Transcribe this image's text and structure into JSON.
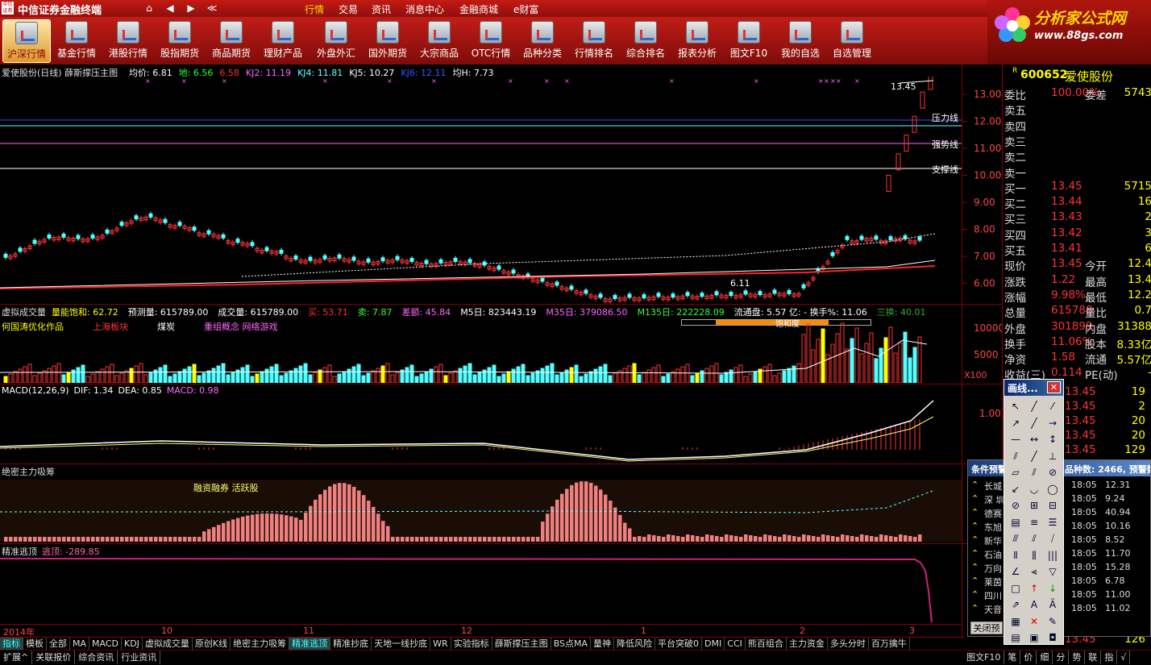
{
  "titlebar": {
    "logo": "中信证券",
    "app_title": "中信证券金融终端",
    "nav": [
      "⌂",
      "◀",
      "▶",
      "≪"
    ],
    "menu": [
      "行情",
      "交易",
      "资讯",
      "消息中心",
      "金融商城",
      "e财富"
    ]
  },
  "toolbar": {
    "items": [
      "沪深行情",
      "基金行情",
      "港股行情",
      "股指期货",
      "商品期货",
      "理财产品",
      "外盘外汇",
      "国外期货",
      "大宗商品",
      "OTC行情",
      "品种分类",
      "行情排名",
      "综合排名",
      "报表分析",
      "图文F10",
      "我的自选",
      "自选管理"
    ]
  },
  "brand": {
    "name": "分析家公式网",
    "url": "www.88gs.com"
  },
  "main_chart": {
    "title": "爱使股份(日线) 薛斯撑压主图",
    "indicators": [
      {
        "label": "均价: 6.81",
        "color": "#ffffff"
      },
      {
        "label": "地: 6.56",
        "color": "#33ff33"
      },
      {
        "label": "6.58",
        "color": "#ff3333"
      },
      {
        "label": "KJ2: 11.19",
        "color": "#ff66ff"
      },
      {
        "label": "KJ4: 11.81",
        "color": "#66ffff"
      },
      {
        "label": "KJ5: 10.27",
        "color": "#ffffff"
      },
      {
        "label": "KJ6: 12.11",
        "color": "#3355ff"
      },
      {
        "label": "均H: 7.73",
        "color": "#ffffff"
      }
    ],
    "line_labels": {
      "pressure": "压力线",
      "strong": "强势线",
      "support": "支撑线"
    },
    "high_label": "13.45",
    "low_label": "6.11",
    "price_axis": [
      "13.00",
      "12.00",
      "11.00",
      "10.00",
      "9.00",
      "8.00",
      "7.00",
      "6.00"
    ],
    "month_axis": [
      "2014年",
      "10",
      "11",
      "12",
      "1",
      "2",
      "3"
    ]
  },
  "volume_panel": {
    "title": "虚拟成交量",
    "stats": [
      {
        "label": "量能饱和: 62.72",
        "color": "#ffff00"
      },
      {
        "label": "预测量: 615789.00",
        "color": "#ffffff"
      },
      {
        "label": "成交量: 615789.00",
        "color": "#ffffff"
      },
      {
        "label": "买: 53.71",
        "color": "#ff3333"
      },
      {
        "label": "卖: 7.87",
        "color": "#33ff33"
      },
      {
        "label": "差额: 45.84",
        "color": "#ff66ff"
      },
      {
        "label": "M5日: 823443.19",
        "color": "#ffffff"
      },
      {
        "label": "M35日: 379086.50",
        "color": "#ff66ff"
      },
      {
        "label": "M135日: 222228.09",
        "color": "#33ff33"
      },
      {
        "label": "流通盘: 5.57 亿: - 换手%: 11.06",
        "color": "#ffffff"
      },
      {
        "label": "三换: 40.01",
        "color": "#33aa33"
      }
    ],
    "tags": [
      {
        "label": "何国涛优化作品",
        "color": "#ffff00"
      },
      {
        "label": "上海板块",
        "color": "#ff3333"
      },
      {
        "label": "煤炭",
        "color": "#ffffff"
      },
      {
        "label": "重组概念 网络游戏",
        "color": "#ff66ff"
      }
    ],
    "sat_label": "饱和度",
    "axis": [
      "10000",
      "5000"
    ],
    "unit": "X100"
  },
  "macd_panel": {
    "stats": [
      {
        "label": "MACD(12,26,9)",
        "color": "#ffffff"
      },
      {
        "label": "DIF: 1.34",
        "color": "#ffffff"
      },
      {
        "label": "DEA: 0.85",
        "color": "#ffffff"
      },
      {
        "label": "MACD: 0.98",
        "color": "#ff66ff"
      }
    ],
    "axis": [
      "1.00"
    ]
  },
  "capital_panel": {
    "title": "绝密主力吸筹",
    "note": "融资融券 活跃股"
  },
  "escape_panel": {
    "title": "精准逃顶",
    "value_label": "逃顶: -289.85"
  },
  "bottom_tabs": [
    "指标",
    "模板",
    "全部",
    "MA",
    "MACD",
    "KDJ",
    "虚拟成交量",
    "原创K线",
    "绝密主力吸筹",
    "精准逃顶",
    "精准抄底",
    "天地一线抄底",
    "WR",
    "实验指标",
    "薛斯撑压主图",
    "BS点MA",
    "量神",
    "降低风险",
    "平台突破0",
    "DMI",
    "CCI",
    "熊百组合",
    "主力资金",
    "多头分时",
    "百万擒牛"
  ],
  "bottom_tabs_active": "精准逃顶",
  "bottom_bar": [
    "扩展^",
    "关联报价",
    "综合资讯",
    "行业资讯"
  ],
  "bottom_bar_right": [
    "图文F10",
    "笔",
    "价",
    "细",
    "分",
    "势",
    "联",
    "指",
    "√"
  ],
  "quote": {
    "code": "600652",
    "name": "爱使股份",
    "mark": "R",
    "ratio_rows": [
      {
        "k": "委比",
        "v": "100.00%",
        "k2": "委差",
        "w": "5743"
      }
    ],
    "sell_labels": [
      "卖五",
      "卖四",
      "卖三",
      "卖二",
      "卖一"
    ],
    "buy_rows": [
      {
        "k": "买一",
        "v": "13.45",
        "w": "5715"
      },
      {
        "k": "买二",
        "v": "13.44",
        "w": "16"
      },
      {
        "k": "买三",
        "v": "13.43",
        "w": "2"
      },
      {
        "k": "买四",
        "v": "13.42",
        "w": "3"
      },
      {
        "k": "买五",
        "v": "13.41",
        "w": "6"
      }
    ],
    "stat_rows": [
      {
        "k": "现价",
        "v": "13.45",
        "k2": "今开",
        "w": "12.4"
      },
      {
        "k": "涨跌",
        "v": "1.22",
        "k2": "最高",
        "w": "13.4"
      },
      {
        "k": "涨幅",
        "v": "9.98%",
        "k2": "最低",
        "w": "12.2"
      },
      {
        "k": "总量",
        "v": "615788",
        "k2": "量比",
        "w": "0.7"
      },
      {
        "k": "外盘",
        "v": "301899",
        "k2": "内盘",
        "w": "31388"
      },
      {
        "k": "换手",
        "v": "11.06%",
        "k2": "股本",
        "w": "8.33亿"
      },
      {
        "k": "净资",
        "v": "1.58",
        "k2": "流通",
        "w": "5.57亿"
      },
      {
        "k": "收益(三)",
        "v": "0.114",
        "k2": "PE(动)",
        "w": "-"
      }
    ],
    "ticks": [
      {
        "p": "13.45",
        "v": "19",
        "d": "S"
      },
      {
        "p": "13.45",
        "v": "2",
        "d": "S"
      },
      {
        "p": "13.45",
        "v": "20",
        "d": "S"
      },
      {
        "p": "13.45",
        "v": "20",
        "d": "S"
      },
      {
        "p": "13.45",
        "v": "129",
        "d": "S"
      }
    ],
    "last_tick": {
      "p": "13.45",
      "v": "126",
      "d": "S"
    }
  },
  "draw_window": {
    "title": "画线..."
  },
  "cond_window": {
    "title": "条件预警",
    "header_right": "品种数: 2466, 预警数",
    "rows": [
      {
        "n": "长城",
        "t": "18:05",
        "p": "12.31"
      },
      {
        "n": "深 圳",
        "t": "18:05",
        "p": "9.24"
      },
      {
        "n": "德赛",
        "t": "18:05",
        "p": "40.94"
      },
      {
        "n": "东旭",
        "t": "18:05",
        "p": "10.16"
      },
      {
        "n": "新华",
        "t": "18:05",
        "p": "8.52"
      },
      {
        "n": "石油",
        "t": "18:05",
        "p": "11.70"
      },
      {
        "n": "万向",
        "t": "18:05",
        "p": "15.28"
      },
      {
        "n": "莱茵",
        "t": "18:05",
        "p": "6.78"
      },
      {
        "n": "四川",
        "t": "18:05",
        "p": "11.00"
      },
      {
        "n": "天音",
        "t": "18:05",
        "p": "11.02"
      }
    ],
    "close_label": "关闭预"
  },
  "colors": {
    "up": "#ff3333",
    "down": "#54ffff",
    "bg": "#000000",
    "title_red": "#c41a14",
    "accent_yellow": "#ffff00"
  }
}
